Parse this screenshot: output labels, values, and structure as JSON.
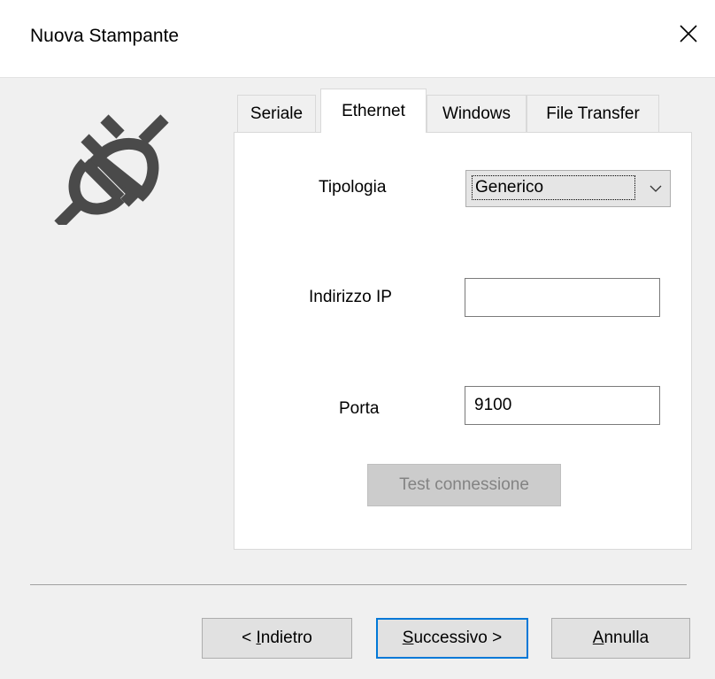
{
  "window": {
    "title": "Nuova Stampante",
    "close_icon": "close-icon"
  },
  "illustration": {
    "icon": "plug-icon",
    "color": "#4a4a4a"
  },
  "tabs": [
    {
      "label": "Seriale",
      "active": false
    },
    {
      "label": "Ethernet",
      "active": true
    },
    {
      "label": "Windows",
      "active": false
    },
    {
      "label": "File Transfer",
      "active": false
    }
  ],
  "form": {
    "tipologia_label": "Tipologia",
    "tipologia_value": "Generico",
    "ip_label": "Indirizzo IP",
    "ip_value": "",
    "porta_label": "Porta",
    "porta_value": "9100",
    "test_button": "Test connessione"
  },
  "footer": {
    "back_prefix": "< ",
    "back_mnemonic": "I",
    "back_rest": "ndietro",
    "next_mnemonic": "S",
    "next_rest": "uccessivo >",
    "cancel_mnemonic": "A",
    "cancel_rest": "nnulla"
  },
  "colors": {
    "accent": "#0078d7",
    "dialog_bg": "#f0f0f0",
    "disabled_text": "#838383"
  }
}
